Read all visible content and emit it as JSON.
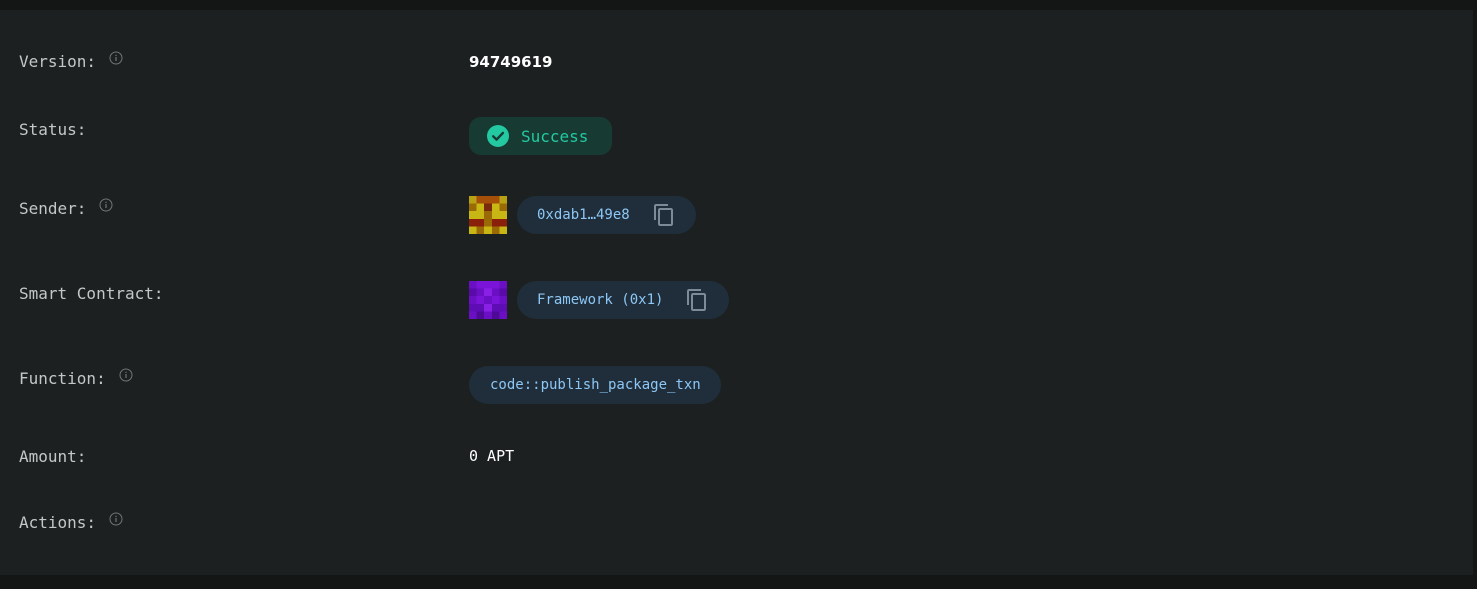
{
  "rows": {
    "version": {
      "label": "Version:",
      "value": "94749619"
    },
    "status": {
      "label": "Status:",
      "value": "Success"
    },
    "sender": {
      "label": "Sender:",
      "value": "0xdab1…49e8"
    },
    "smart_contract": {
      "label": "Smart Contract:",
      "value": "Framework (0x1)"
    },
    "function": {
      "label": "Function:",
      "value": "code::publish_package_txn"
    },
    "amount": {
      "label": "Amount:",
      "value": "0 APT"
    },
    "actions": {
      "label": "Actions:"
    }
  },
  "icons": {
    "info": "info-icon",
    "success": "check-circle-icon",
    "copy": "copy-icon"
  },
  "colors": {
    "background": "#1c2020",
    "label": "#c3c8c6",
    "success_text": "#23c9a1",
    "success_bg": "#173a33",
    "chip_bg": "#1f2e3a",
    "chip_text": "#8dc7f5",
    "icon": "#7c8b97"
  }
}
